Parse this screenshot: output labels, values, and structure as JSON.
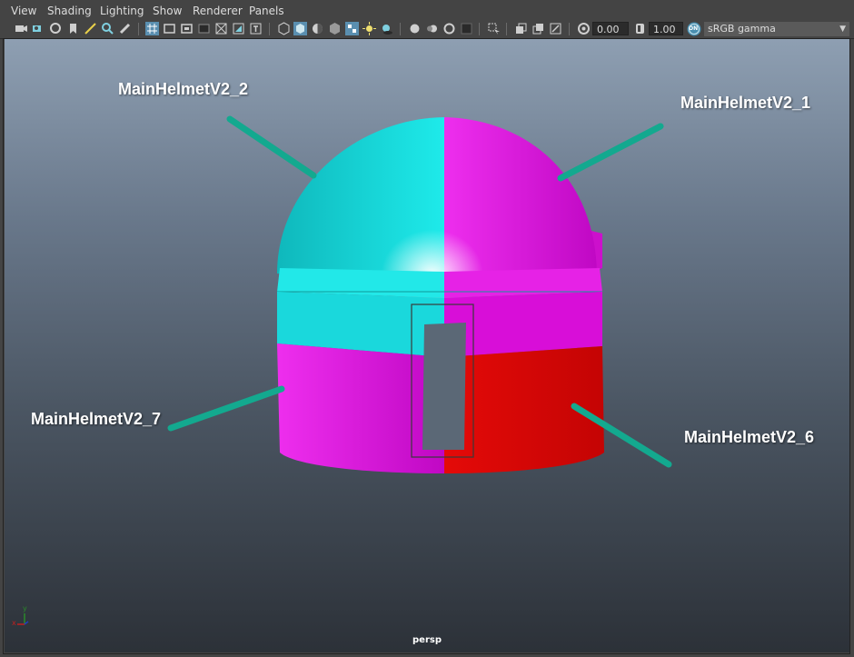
{
  "menubar": {
    "items": [
      "View",
      "Shading",
      "Lighting",
      "Show",
      "Renderer",
      "Panels"
    ]
  },
  "toolbar": {
    "exposure_value": "0.00",
    "gamma_value": "1.00",
    "colorspace_toggle": "ON",
    "colorspace": "sRGB gamma",
    "icons": [
      "select-camera-icon",
      "camera-attributes-icon",
      "bookmark-icon",
      "image-plane-icon",
      "grid-icon",
      "wireframe-icon",
      "smooth-shade-icon",
      "textured-icon",
      "lights-icon",
      "shadows-icon",
      "isolate-icon",
      "xray-icon",
      "exposure-icon",
      "gamma-icon"
    ]
  },
  "viewport": {
    "camera_name": "persp",
    "annotations": [
      {
        "id": "helmet-2",
        "text": "MainHelmetV2_2"
      },
      {
        "id": "helmet-1",
        "text": "MainHelmetV2_1"
      },
      {
        "id": "helmet-7",
        "text": "MainHelmetV2_7"
      },
      {
        "id": "helmet-6",
        "text": "MainHelmetV2_6"
      }
    ],
    "colors": {
      "cyan": "#18e6e6",
      "magenta": "#e414e4",
      "red": "#e00808",
      "leader_line": "#13a98f"
    },
    "axis_labels": {
      "x": "x",
      "y": "y"
    }
  }
}
